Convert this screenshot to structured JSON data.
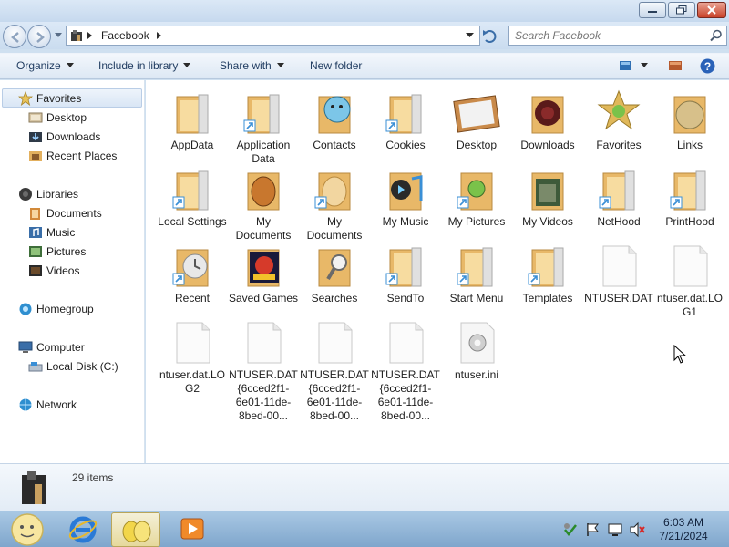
{
  "window": {
    "address_crumb": "Facebook",
    "search_placeholder": "Search Facebook"
  },
  "toolbar": {
    "organize": "Organize",
    "include_in_library": "Include in library",
    "share_with": "Share with",
    "new_folder": "New folder"
  },
  "nav": {
    "favorites": "Favorites",
    "desktop": "Desktop",
    "downloads": "Downloads",
    "recent_places": "Recent Places",
    "libraries": "Libraries",
    "documents": "Documents",
    "music": "Music",
    "pictures": "Pictures",
    "videos": "Videos",
    "homegroup": "Homegroup",
    "computer": "Computer",
    "local_disk": "Local Disk (C:)",
    "network": "Network"
  },
  "items": [
    {
      "label": "AppData",
      "icon": "folder-icon"
    },
    {
      "label": "Application Data",
      "icon": "folder-shortcut-icon"
    },
    {
      "label": "Contacts",
      "icon": "contacts-folder-icon"
    },
    {
      "label": "Cookies",
      "icon": "folder-shortcut-icon"
    },
    {
      "label": "Desktop",
      "icon": "desktop-folder-icon"
    },
    {
      "label": "Downloads",
      "icon": "downloads-folder-icon"
    },
    {
      "label": "Favorites",
      "icon": "favorites-folder-icon"
    },
    {
      "label": "Links",
      "icon": "links-folder-icon"
    },
    {
      "label": "Local Settings",
      "icon": "folder-shortcut-icon"
    },
    {
      "label": "My Documents",
      "icon": "documents-folder-icon"
    },
    {
      "label": "My Documents",
      "icon": "folder-shortcut-icon"
    },
    {
      "label": "My Music",
      "icon": "music-folder-icon"
    },
    {
      "label": "My Pictures",
      "icon": "pictures-folder-icon"
    },
    {
      "label": "My Videos",
      "icon": "videos-folder-icon"
    },
    {
      "label": "NetHood",
      "icon": "folder-shortcut-icon"
    },
    {
      "label": "PrintHood",
      "icon": "folder-shortcut-icon"
    },
    {
      "label": "Recent",
      "icon": "recent-folder-icon"
    },
    {
      "label": "Saved Games",
      "icon": "saved-games-folder-icon"
    },
    {
      "label": "Searches",
      "icon": "searches-folder-icon"
    },
    {
      "label": "SendTo",
      "icon": "folder-shortcut-icon"
    },
    {
      "label": "Start Menu",
      "icon": "folder-shortcut-icon"
    },
    {
      "label": "Templates",
      "icon": "folder-shortcut-icon"
    },
    {
      "label": "NTUSER.DAT",
      "icon": "file-icon"
    },
    {
      "label": "ntuser.dat.LOG1",
      "icon": "file-icon"
    },
    {
      "label": "ntuser.dat.LOG2",
      "icon": "file-icon"
    },
    {
      "label": "NTUSER.DAT{6cced2f1-6e01-11de-8bed-00...",
      "icon": "file-icon"
    },
    {
      "label": "NTUSER.DAT{6cced2f1-6e01-11de-8bed-00...",
      "icon": "file-icon"
    },
    {
      "label": "NTUSER.DAT{6cced2f1-6e01-11de-8bed-00...",
      "icon": "file-icon"
    },
    {
      "label": "ntuser.ini",
      "icon": "settings-file-icon"
    }
  ],
  "details": {
    "count": "29 items"
  },
  "taskbar": {
    "time": "6:03 AM",
    "date": "7/21/2024"
  },
  "colors": {
    "folder": "#e8b868",
    "folder_light": "#f7dca0",
    "shortcut": "#3a8fd6",
    "selection": "#d9e6f5"
  }
}
